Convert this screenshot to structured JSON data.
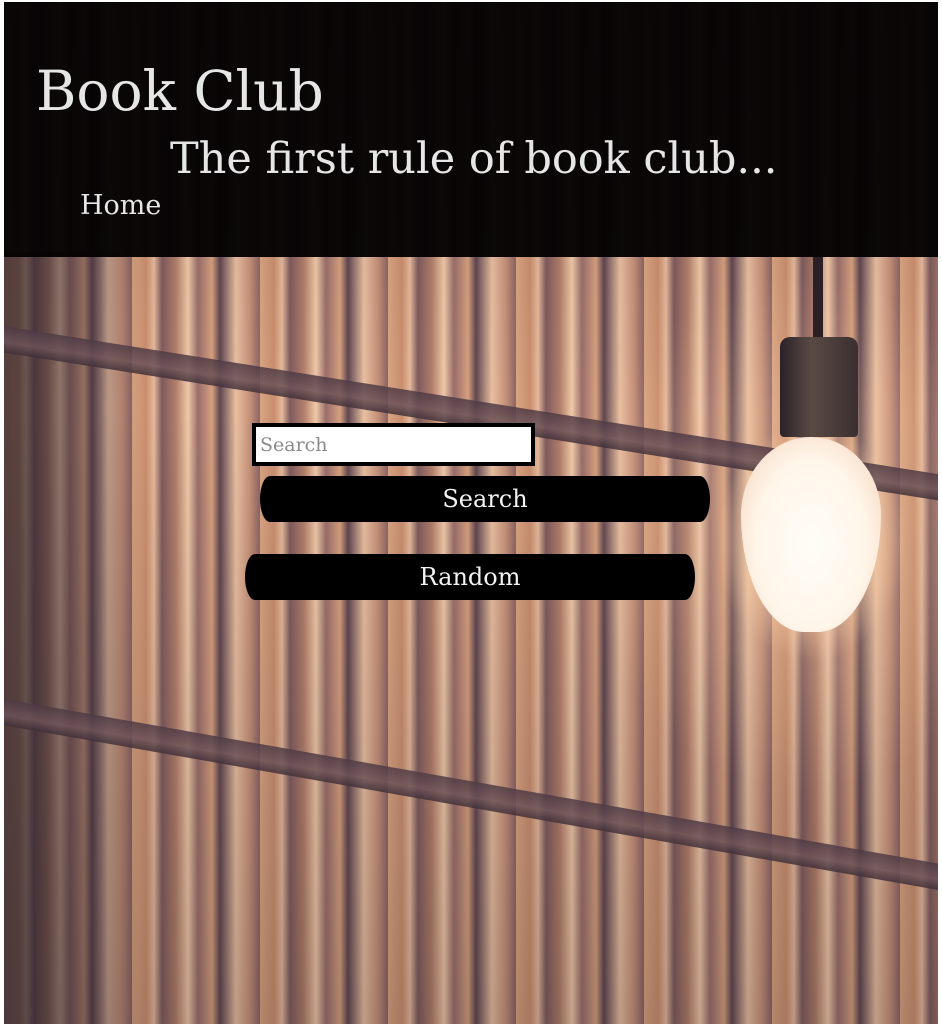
{
  "header": {
    "title": "Book Club",
    "tagline": "The first rule of book club...",
    "nav": [
      {
        "label": "Home"
      }
    ]
  },
  "search": {
    "placeholder": "Search",
    "value": "",
    "submit_label": "Search",
    "random_label": "Random"
  },
  "colors": {
    "header_background": "#040203",
    "header_text": "#e6e6e6",
    "button_background": "#000000",
    "button_text": "#f2f2f2",
    "input_border": "#000000"
  },
  "background": {
    "image_subject": "library-bookshelf-with-hanging-light-bulb"
  }
}
